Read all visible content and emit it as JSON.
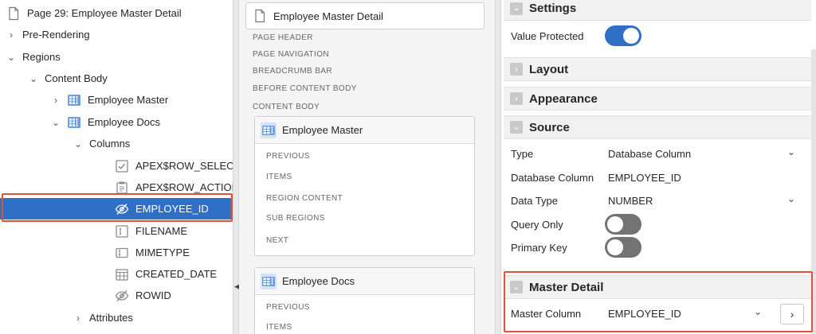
{
  "tree": {
    "page": "Page 29: Employee Master Detail",
    "pre_rendering": "Pre-Rendering",
    "regions": "Regions",
    "content_body": "Content Body",
    "employee_master": "Employee Master",
    "employee_docs": "Employee Docs",
    "columns": "Columns",
    "col_row_selector": "APEX$ROW_SELECTOR",
    "col_row_action": "APEX$ROW_ACTION",
    "col_employee_id": "EMPLOYEE_ID",
    "col_filename": "FILENAME",
    "col_mimetype": "MIMETYPE",
    "col_created_date": "CREATED_DATE",
    "col_rowid": "ROWID",
    "attributes": "Attributes"
  },
  "layout": {
    "page_title": "Employee Master Detail",
    "positions": [
      "PAGE HEADER",
      "PAGE NAVIGATION",
      "BREADCRUMB BAR",
      "BEFORE CONTENT BODY",
      "CONTENT BODY"
    ],
    "region1": {
      "title": "Employee Master",
      "sub_positions": [
        "PREVIOUS",
        "ITEMS",
        "REGION CONTENT",
        "SUB REGIONS",
        "NEXT"
      ]
    },
    "region2": {
      "title": "Employee Docs",
      "sub_positions": [
        "PREVIOUS",
        "ITEMS"
      ]
    }
  },
  "props": {
    "settings": {
      "title": "Settings",
      "value_protected_label": "Value Protected",
      "value_protected": true
    },
    "layout_title": "Layout",
    "appearance_title": "Appearance",
    "source": {
      "title": "Source",
      "type_label": "Type",
      "type_value": "Database Column",
      "db_column_label": "Database Column",
      "db_column_value": "EMPLOYEE_ID",
      "data_type_label": "Data Type",
      "data_type_value": "NUMBER",
      "query_only_label": "Query Only",
      "query_only": false,
      "primary_key_label": "Primary Key",
      "primary_key": false
    },
    "master_detail": {
      "title": "Master Detail",
      "master_column_label": "Master Column",
      "master_column_value": "EMPLOYEE_ID"
    }
  },
  "colors": {
    "accent": "#2f6fc6",
    "highlight_outline": "#e0513b",
    "toggle_off": "#737373"
  }
}
